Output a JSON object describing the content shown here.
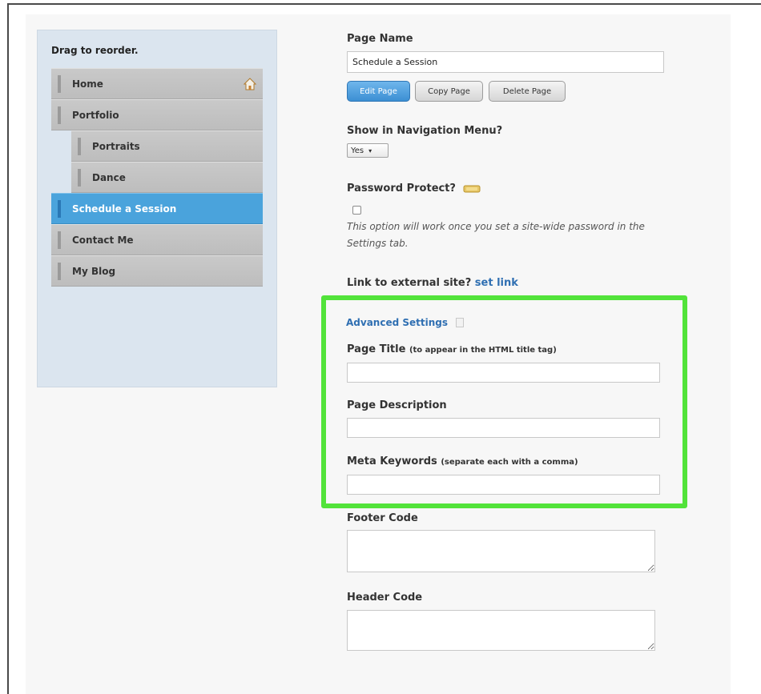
{
  "sidebar": {
    "title": "Drag to reorder.",
    "items": [
      {
        "label": "Home",
        "level": 0,
        "active": false,
        "icon": "home-icon"
      },
      {
        "label": "Portfolio",
        "level": 0,
        "active": false
      },
      {
        "label": "Portraits",
        "level": 1,
        "active": false
      },
      {
        "label": "Dance",
        "level": 1,
        "active": false
      },
      {
        "label": "Schedule a Session",
        "level": 0,
        "active": true
      },
      {
        "label": "Contact Me",
        "level": 0,
        "active": false
      },
      {
        "label": "My Blog",
        "level": 0,
        "active": false
      }
    ]
  },
  "form": {
    "page_name_label": "Page Name",
    "page_name_value": "Schedule a Session",
    "buttons": {
      "edit": "Edit Page",
      "copy": "Copy Page",
      "delete": "Delete Page"
    },
    "show_nav_label": "Show in Navigation Menu?",
    "show_nav_value": "Yes",
    "password_label": "Password Protect?",
    "password_note": "This option will work once you set a site-wide password in the Settings tab.",
    "external_label": "Link to external site?",
    "external_link": "set link",
    "advanced_link": "Advanced Settings",
    "page_title_label": "Page Title",
    "page_title_hint": "(to appear in the HTML title tag)",
    "page_description_label": "Page Description",
    "meta_keywords_label": "Meta Keywords",
    "meta_keywords_hint": "(separate each with a comma)",
    "footer_code_label": "Footer Code",
    "header_code_label": "Header Code"
  },
  "colors": {
    "active_nav": "#4aa3dc",
    "highlight_box": "#52e33a",
    "link": "#2f6fb2"
  }
}
